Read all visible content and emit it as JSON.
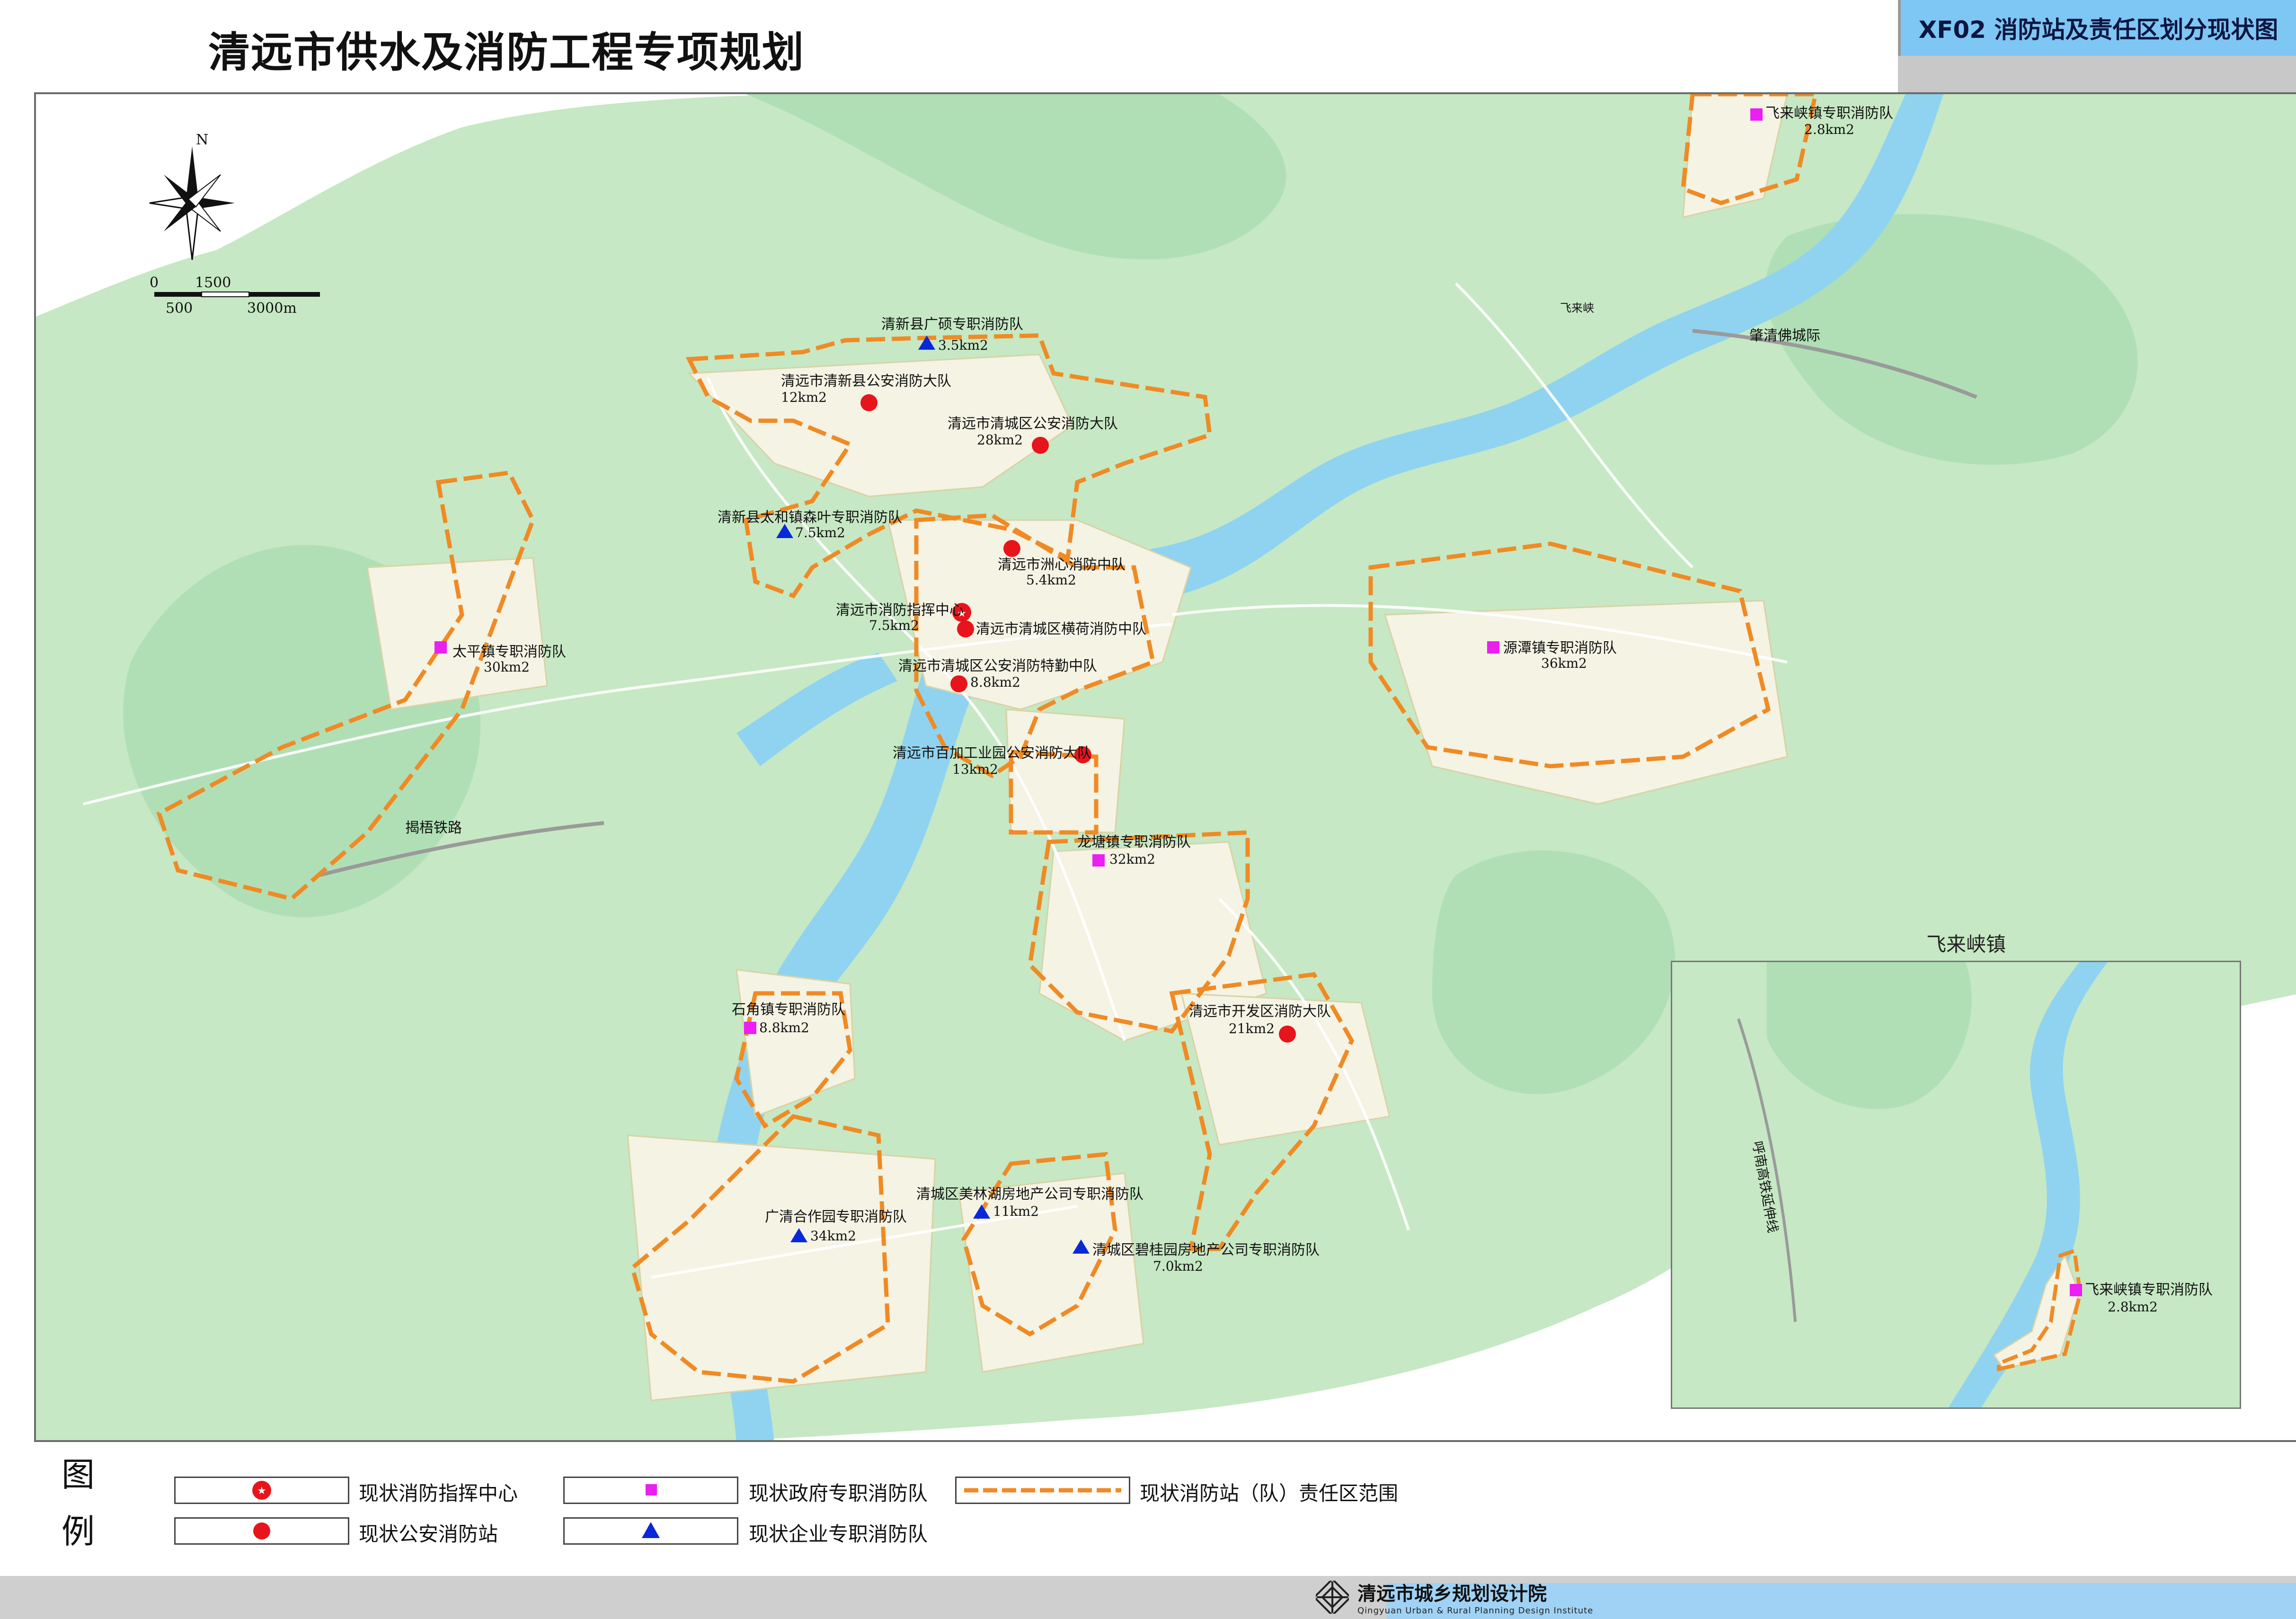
{
  "title": "清远市供水及消防工程专项规划",
  "map_code": "XF02 消防站及责任区划分现状图",
  "compass": {
    "north_label": "N"
  },
  "scale_bar": {
    "labels": [
      "0",
      "1500",
      "500",
      "3000m"
    ]
  },
  "stations": [
    {
      "name": "清新县广硕专职消防队",
      "area": "3.5km2",
      "type": "enterprise"
    },
    {
      "name": "清远市清新县公安消防大队",
      "area": "12km2",
      "type": "police"
    },
    {
      "name": "清远市清城区公安消防大队",
      "area": "28km2",
      "type": "police"
    },
    {
      "name": "清新县太和镇森叶专职消防队",
      "area": "7.5km2",
      "type": "enterprise"
    },
    {
      "name": "清远市洲心消防中队",
      "area": "5.4km2",
      "type": "police"
    },
    {
      "name": "清远市消防指挥中心",
      "area": "7.5km2",
      "type": "command"
    },
    {
      "name": "清远市清城区横荷消防中队",
      "area": "",
      "type": "police"
    },
    {
      "name": "清远市清城区公安消防特勤中队",
      "area": "8.8km2",
      "type": "police"
    },
    {
      "name": "太平镇专职消防队",
      "area": "30km2",
      "type": "government"
    },
    {
      "name": "源潭镇专职消防队",
      "area": "36km2",
      "type": "government"
    },
    {
      "name": "清远市百加工业园公安消防大队",
      "area": "13km2",
      "type": "police"
    },
    {
      "name": "龙塘镇专职消防队",
      "area": "32km2",
      "type": "government"
    },
    {
      "name": "石角镇专职消防队",
      "area": "8.8km2",
      "type": "government"
    },
    {
      "name": "清远市开发区消防大队",
      "area": "21km2",
      "type": "police"
    },
    {
      "name": "广清合作园专职消防队",
      "area": "34km2",
      "type": "enterprise"
    },
    {
      "name": "清城区美林湖房地产公司专职消防队",
      "area": "11km2",
      "type": "enterprise"
    },
    {
      "name": "清城区碧桂园房地产公司专职消防队",
      "area": "7.0km2",
      "type": "enterprise"
    },
    {
      "name": "飞来峡镇专职消防队",
      "area": "2.8km2",
      "type": "government"
    }
  ],
  "map_labels": {
    "railway_1": "揭梧铁路",
    "railway_2": "肇清佛城际",
    "railway_3": "呼南高铁延伸线",
    "place_1": "飞来峡"
  },
  "inset": {
    "title": "飞来峡镇",
    "station_name": "飞来峡镇专职消防队",
    "station_area": "2.8km2"
  },
  "legend": {
    "head_1": "图",
    "head_2": "例",
    "items": [
      {
        "label": "现状消防指挥中心",
        "symbol": "command"
      },
      {
        "label": "现状公安消防站",
        "symbol": "police"
      },
      {
        "label": "现状政府专职消防队",
        "symbol": "government"
      },
      {
        "label": "现状企业专职消防队",
        "symbol": "enterprise"
      },
      {
        "label": "现状消防站（队）责任区范围",
        "symbol": "boundary"
      }
    ]
  },
  "colors": {
    "land": "#c6e8c4",
    "hill": "#a9dcb2",
    "water": "#8fd3f0",
    "urban": "#f4f3e4",
    "boundary": "#f08a24",
    "police": "#e8141b",
    "government": "#ea1ff0",
    "enterprise": "#0a28d8"
  },
  "footer": {
    "org_cn": "清远市城乡规划设计院",
    "org_en": "Qingyuan Urban & Rural Planning Design Institute"
  }
}
